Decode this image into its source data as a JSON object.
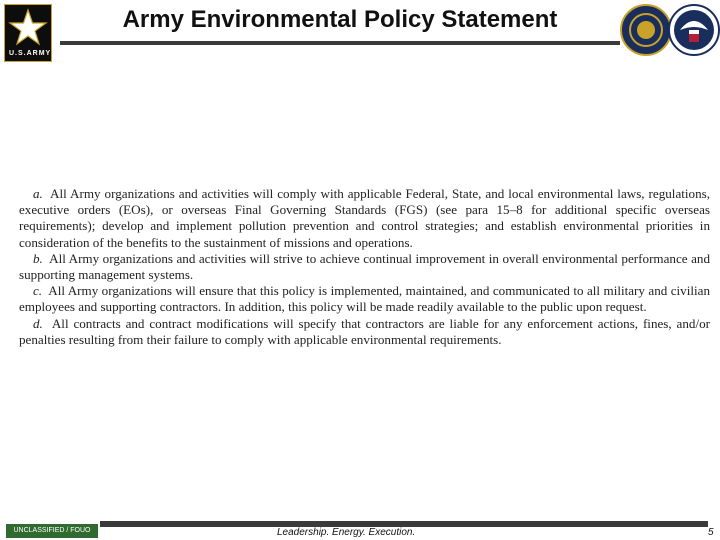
{
  "header": {
    "title": "Army Environmental Policy Statement",
    "logo_text": "U.S.ARMY",
    "icons": [
      "army-star-logo",
      "seal-emblem",
      "eagle-emblem"
    ]
  },
  "body": {
    "paragraphs": [
      {
        "label": "a.",
        "text": "All Army organizations and activities will comply with applicable Federal, State, and local environmental laws, regulations, executive orders (EOs), or overseas Final Governing Standards (FGS) (see para 15–8 for additional specific overseas requirements); develop and implement pollution prevention and control strategies; and establish environmental priorities in consideration of the benefits to the sustainment of missions and operations."
      },
      {
        "label": "b.",
        "text": "All Army organizations and activities will strive to achieve continual improvement in overall environmental performance and supporting management systems."
      },
      {
        "label": "c.",
        "text": "All Army organizations will ensure that this policy is implemented, maintained, and communicated to all military and civilian employees and supporting contractors. In addition, this policy will be made readily available to the public upon request."
      },
      {
        "label": "d.",
        "text": "All contracts and contract modifications will specify that contractors are liable for any enforcement actions, fines, and/or penalties resulting from their failure to comply with applicable environmental requirements."
      }
    ]
  },
  "footer": {
    "classification": "UNCLASSIFIED / FOUO",
    "tagline": "Leadership. Energy. Execution.",
    "page_number": "5"
  },
  "colors": {
    "rule": "#3a3a3a",
    "classification_bg": "#2f6b2f",
    "seal_navy": "#1a2e5e",
    "seal_gold": "#c9a227"
  }
}
